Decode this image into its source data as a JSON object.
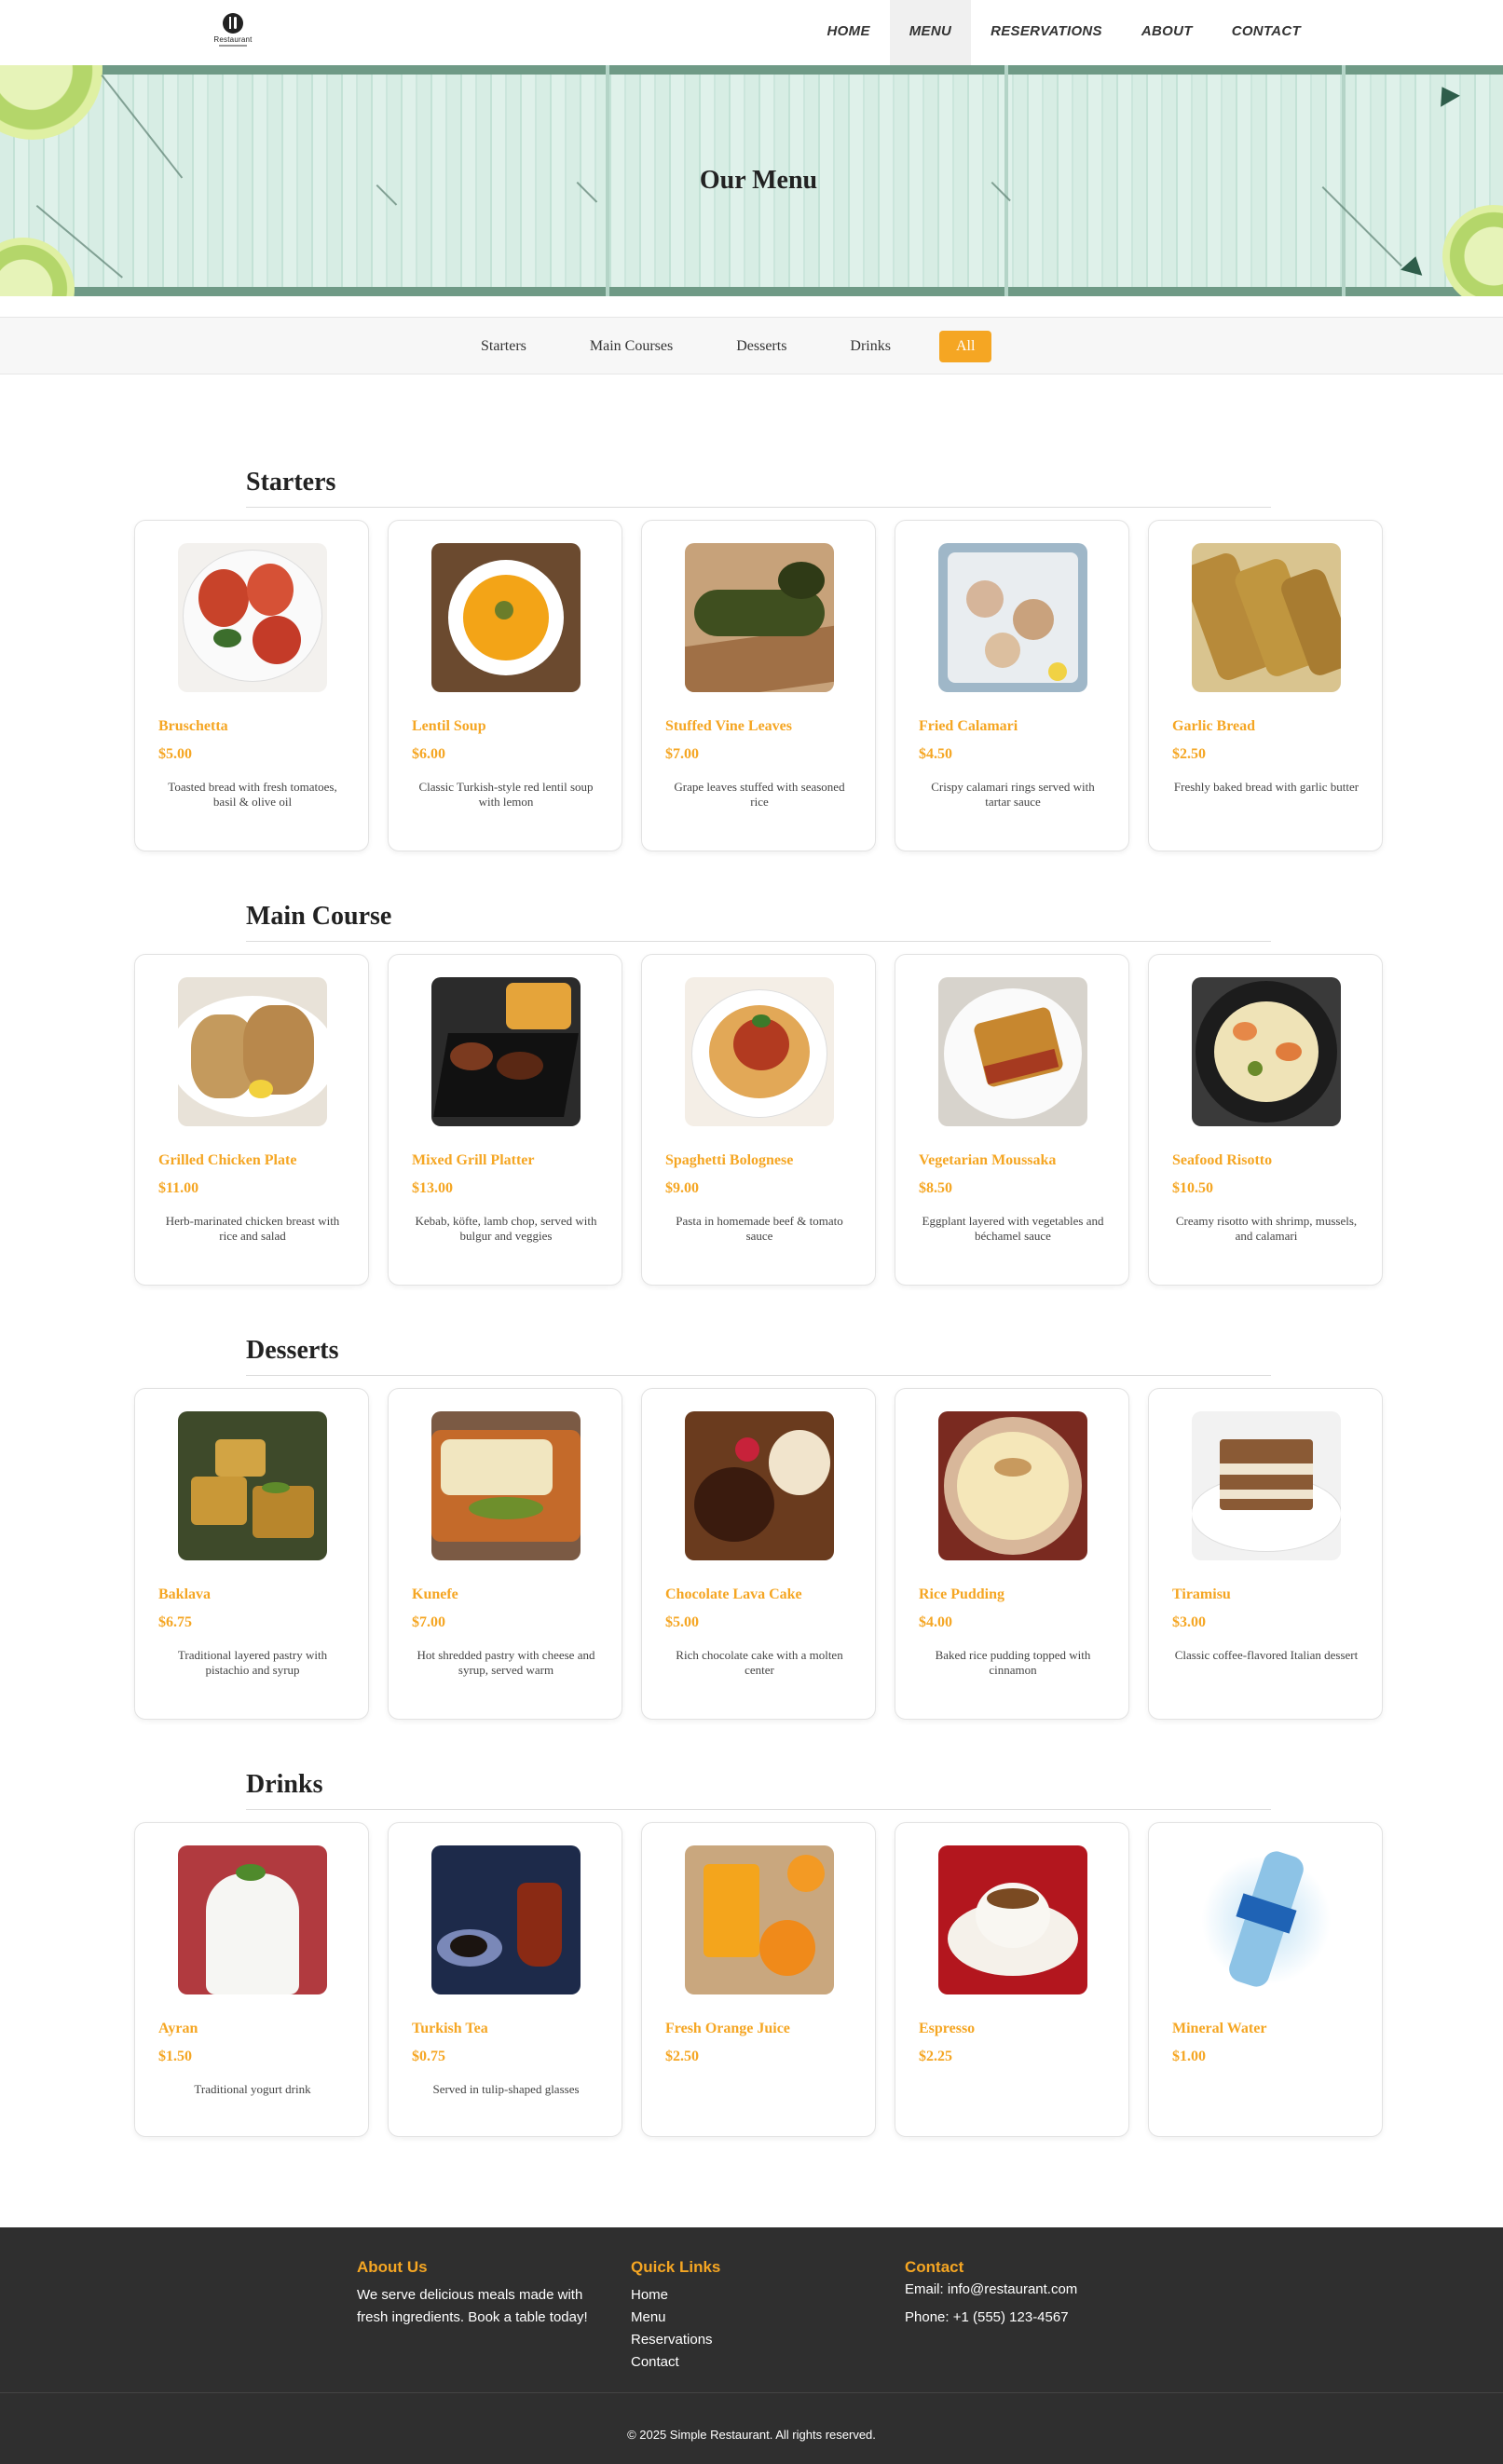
{
  "nav": {
    "logo_text": "Restaurant",
    "items": [
      {
        "label": "HOME",
        "active": false
      },
      {
        "label": "MENU",
        "active": true
      },
      {
        "label": "RESERVATIONS",
        "active": false
      },
      {
        "label": "ABOUT",
        "active": false
      },
      {
        "label": "CONTACT",
        "active": false
      }
    ]
  },
  "hero": {
    "title": "Our Menu"
  },
  "filter": {
    "tabs": [
      "Starters",
      "Main Courses",
      "Desserts",
      "Drinks",
      "All"
    ],
    "selected": "All",
    "accent": "#f5a623"
  },
  "sections": [
    {
      "title": "Starters",
      "items": [
        {
          "name": "Bruschetta",
          "price": "$5.00",
          "desc": "Toasted bread with fresh tomatoes, basil & olive oil",
          "icon": "bruschetta-photo"
        },
        {
          "name": "Lentil Soup",
          "price": "$6.00",
          "desc": "Classic Turkish-style red lentil soup with lemon",
          "icon": "lentil-soup-photo"
        },
        {
          "name": "Stuffed Vine Leaves",
          "price": "$7.00",
          "desc": "Grape leaves stuffed with seasoned rice",
          "icon": "vine-leaves-photo"
        },
        {
          "name": "Fried Calamari",
          "price": "$4.50",
          "desc": "Crispy calamari rings served with tartar sauce",
          "icon": "calamari-photo"
        },
        {
          "name": "Garlic Bread",
          "price": "$2.50",
          "desc": "Freshly baked bread with garlic butter",
          "icon": "garlic-bread-photo"
        }
      ]
    },
    {
      "title": "Main Course",
      "items": [
        {
          "name": "Grilled Chicken Plate",
          "price": "$11.00",
          "desc": "Herb-marinated chicken breast with rice and salad",
          "icon": "grilled-chicken-photo"
        },
        {
          "name": "Mixed Grill Platter",
          "price": "$13.00",
          "desc": "Kebab, köfte, lamb chop, served with bulgur and veggies",
          "icon": "mixed-grill-photo"
        },
        {
          "name": "Spaghetti Bolognese",
          "price": "$9.00",
          "desc": "Pasta in homemade beef & tomato sauce",
          "icon": "spaghetti-photo"
        },
        {
          "name": "Vegetarian Moussaka",
          "price": "$8.50",
          "desc": "Eggplant layered with vegetables and béchamel sauce",
          "icon": "moussaka-photo"
        },
        {
          "name": "Seafood Risotto",
          "price": "$10.50",
          "desc": "Creamy risotto with shrimp, mussels, and calamari",
          "icon": "risotto-photo"
        }
      ]
    },
    {
      "title": "Desserts",
      "items": [
        {
          "name": "Baklava",
          "price": "$6.75",
          "desc": "Traditional layered pastry with pistachio and syrup",
          "icon": "baklava-photo"
        },
        {
          "name": "Kunefe",
          "price": "$7.00",
          "desc": "Hot shredded pastry with cheese and syrup, served warm",
          "icon": "kunefe-photo"
        },
        {
          "name": "Chocolate Lava Cake",
          "price": "$5.00",
          "desc": "Rich chocolate cake with a molten center",
          "icon": "lava-cake-photo"
        },
        {
          "name": "Rice Pudding",
          "price": "$4.00",
          "desc": "Baked rice pudding topped with cinnamon",
          "icon": "rice-pudding-photo"
        },
        {
          "name": "Tiramisu",
          "price": "$3.00",
          "desc": "Classic coffee-flavored Italian dessert",
          "icon": "tiramisu-photo"
        }
      ]
    },
    {
      "title": "Drinks",
      "items": [
        {
          "name": "Ayran",
          "price": "$1.50",
          "desc": "Traditional yogurt drink",
          "icon": "ayran-photo"
        },
        {
          "name": "Turkish Tea",
          "price": "$0.75",
          "desc": "Served in tulip-shaped glasses",
          "icon": "turkish-tea-photo"
        },
        {
          "name": "Fresh Orange Juice",
          "price": "$2.50",
          "desc": "",
          "icon": "orange-juice-photo"
        },
        {
          "name": "Espresso",
          "price": "$2.25",
          "desc": "",
          "icon": "espresso-photo"
        },
        {
          "name": "Mineral Water",
          "price": "$1.00",
          "desc": "",
          "icon": "mineral-water-photo"
        }
      ]
    }
  ],
  "footer": {
    "about": {
      "title": "About Us",
      "text_line1": "We serve delicious meals made with",
      "text_line2": "fresh ingredients. Book a table today!"
    },
    "links": {
      "title": "Quick Links",
      "items": [
        "Home",
        "Menu",
        "Reservations",
        "Contact"
      ]
    },
    "contact": {
      "title": "Contact",
      "email": "Email: info@restaurant.com",
      "phone": "Phone: +1 (555) 123-4567"
    },
    "copyright": "© 2025 Simple Restaurant. All rights reserved."
  }
}
